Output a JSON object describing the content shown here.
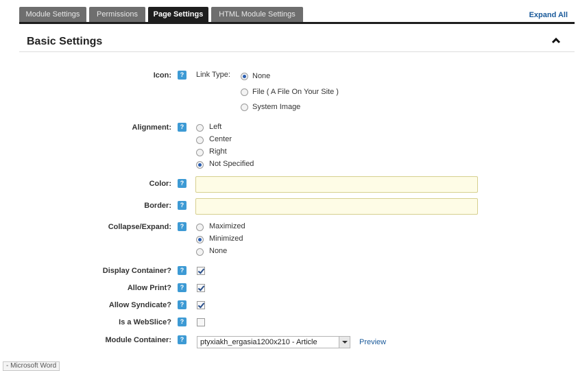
{
  "tabs": [
    {
      "label": "Module Settings",
      "active": false
    },
    {
      "label": "Permissions",
      "active": false
    },
    {
      "label": "Page Settings",
      "active": true
    },
    {
      "label": "HTML Module Settings",
      "active": false
    }
  ],
  "expand_all_label": "Expand All",
  "section": {
    "title": "Basic Settings"
  },
  "form": {
    "icon": {
      "label": "Icon:",
      "link_type_label": "Link Type:",
      "options": [
        "None",
        "File ( A File On Your Site )",
        "System Image"
      ],
      "selected": "None"
    },
    "alignment": {
      "label": "Alignment:",
      "options": [
        "Left",
        "Center",
        "Right",
        "Not Specified"
      ],
      "selected": "Not Specified"
    },
    "color": {
      "label": "Color:",
      "value": ""
    },
    "border": {
      "label": "Border:",
      "value": ""
    },
    "collapse": {
      "label": "Collapse/Expand:",
      "options": [
        "Maximized",
        "Minimized",
        "None"
      ],
      "selected": "Minimized"
    },
    "display_container": {
      "label": "Display Container?",
      "checked": true
    },
    "allow_print": {
      "label": "Allow Print?",
      "checked": true
    },
    "allow_syndicate": {
      "label": "Allow Syndicate?",
      "checked": true
    },
    "is_webslice": {
      "label": "Is a WebSlice?",
      "checked": false
    },
    "module_container": {
      "label": "Module Container:",
      "value": "ptyxiakh_ergasia1200x210 - Article",
      "preview_label": "Preview"
    }
  },
  "help_icon_glyph": "?",
  "taskbar": {
    "label": "- Microsoft Word"
  },
  "colors": {
    "accent": "#1a5a9a",
    "tab_bg": "#6e6e6e",
    "tab_active": "#1e1e1e",
    "input_bg": "#fefce6",
    "help": "#3d9ad4"
  }
}
